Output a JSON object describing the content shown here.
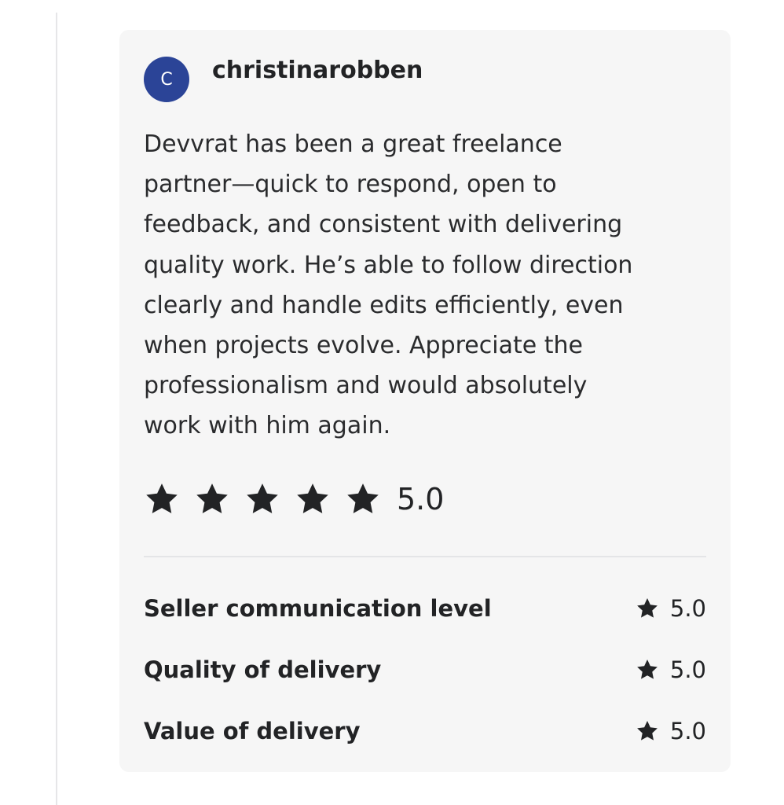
{
  "review": {
    "avatar_initial": "C",
    "username": "christinarobben",
    "text": "Devvrat has been a great freelance\npartner—quick to respond, open to\nfeedback, and consistent with delivering\nquality work. He’s able to follow direction\nclearly and handle edits efficiently, even\nwhen projects evolve. Appreciate the\nprofessionalism and would absolutely\nwork with him again.",
    "rating": {
      "stars_filled": 5,
      "stars_total": 5,
      "value_label": "5.0"
    },
    "breakdown": [
      {
        "label": "Seller communication level",
        "value": "5.0"
      },
      {
        "label": "Quality of delivery",
        "value": "5.0"
      },
      {
        "label": "Value of delivery",
        "value": "5.0"
      }
    ]
  },
  "icons": {
    "rating_star": "star-icon"
  },
  "colors": {
    "avatar_background": "#2b4497",
    "card_background": "#f6f6f6",
    "star": "#222325",
    "text": "#222325"
  }
}
